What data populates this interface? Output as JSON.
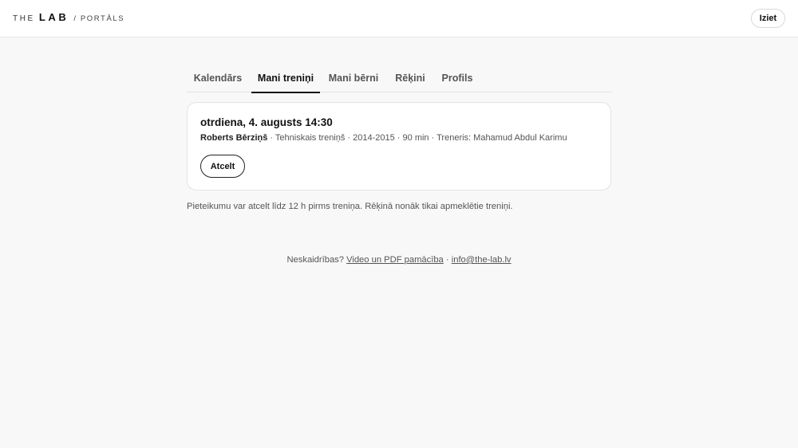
{
  "header": {
    "brand_the": "THE",
    "brand_lab": "LAB",
    "brand_sub": "/ PORTĀLS",
    "logout_label": "Iziet"
  },
  "tabs": [
    {
      "label": "Kalendārs",
      "active": false
    },
    {
      "label": "Mani treniņi",
      "active": true
    },
    {
      "label": "Mani bērni",
      "active": false
    },
    {
      "label": "Rēķini",
      "active": false
    },
    {
      "label": "Profils",
      "active": false
    }
  ],
  "session": {
    "title": "otrdiena, 4. augusts 14:30",
    "child": "Roberts Bērziņš",
    "details": " · Tehniskais treniņš · 2014-2015 · 90 min · Treneris: Mahamud Abdul Karimu",
    "cancel_label": "Atcelt"
  },
  "note": "Pieteikumu var atcelt līdz 12 h pirms treniņa. Rēķinā nonāk tikai apmeklētie treniņi.",
  "footer": {
    "question": "Neskaidrības?",
    "guide_link": "Video un PDF pamācība",
    "separator": "·",
    "email_link": "info@the-lab.lv"
  }
}
